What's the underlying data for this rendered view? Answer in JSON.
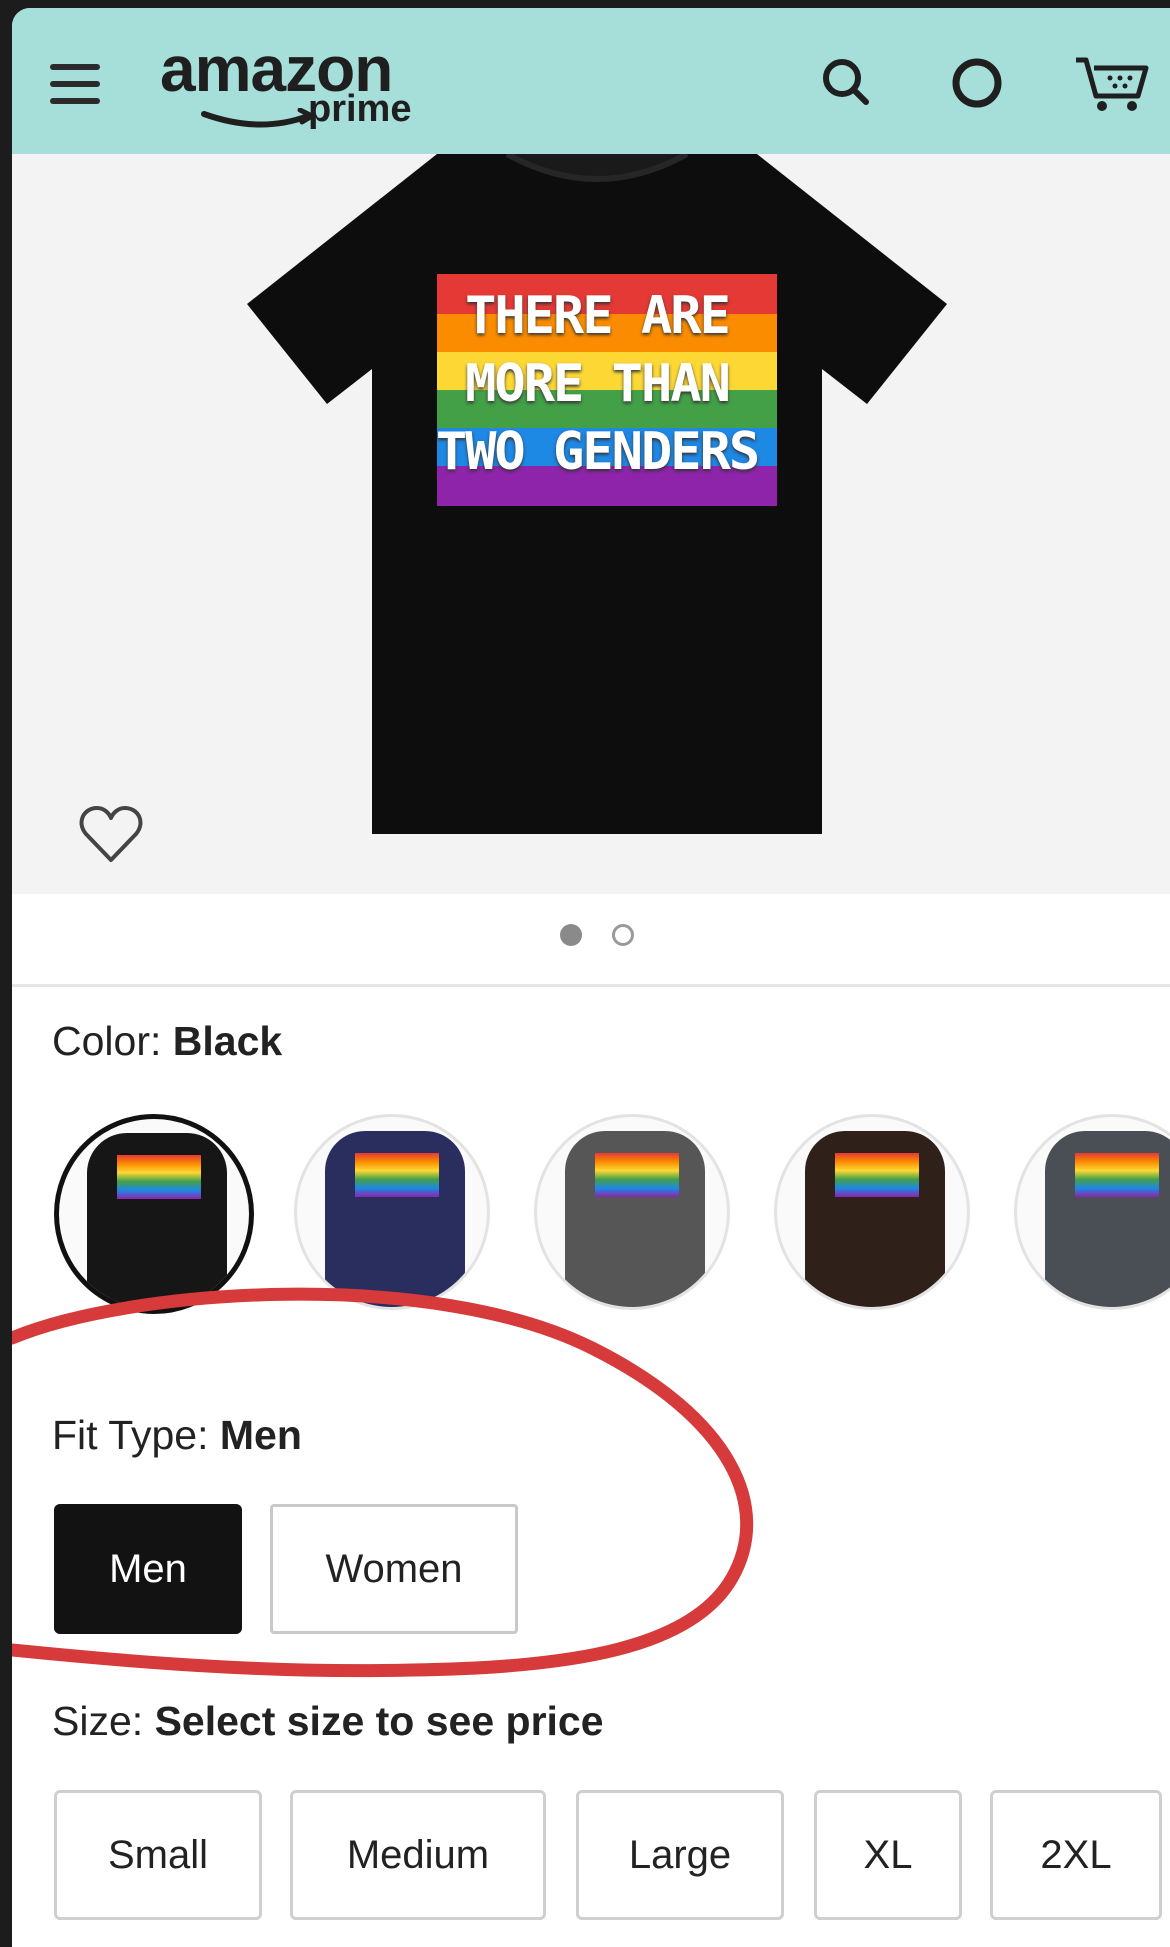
{
  "header": {
    "logo_main": "amazon",
    "logo_sub": "prime",
    "icons": [
      "hamburger-menu-icon",
      "search-icon",
      "alexa-icon",
      "cart-icon"
    ],
    "background_color": "#a6ded9"
  },
  "product": {
    "shirt_lines": [
      "THERE ARE",
      "MORE THAN",
      "TWO GENDERS"
    ],
    "carousel": {
      "current": 1,
      "total": 2
    }
  },
  "color": {
    "label": "Color:",
    "value": "Black",
    "swatches": [
      {
        "color": "#161616"
      },
      {
        "color": "#2a2e5e"
      },
      {
        "color": "#565656"
      },
      {
        "color": "#2f211a"
      },
      {
        "color": "#4a4e55"
      }
    ]
  },
  "fit": {
    "label": "Fit Type:",
    "value": "Men",
    "options": [
      "Men",
      "Women"
    ]
  },
  "size": {
    "label": "Size:",
    "value": "Select size to see price",
    "options": [
      "Small",
      "Medium",
      "Large",
      "XL",
      "2XL"
    ]
  },
  "annotation": {
    "color": "#d63a3a"
  }
}
